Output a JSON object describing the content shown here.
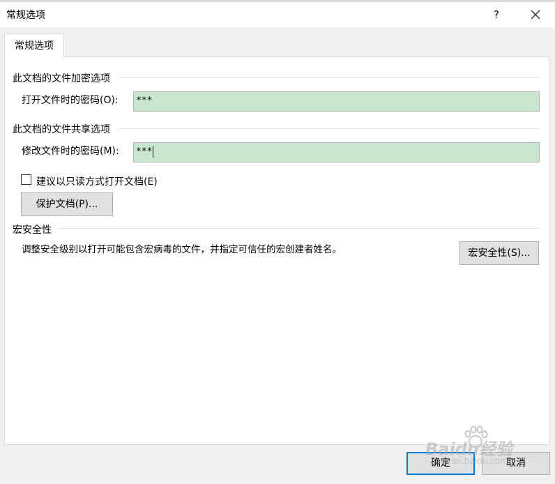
{
  "dialog": {
    "title": "常规选项",
    "help": "?"
  },
  "tab": {
    "label": "常规选项"
  },
  "encryption": {
    "heading": "此文档的文件加密选项",
    "open_label": "打开文件时的密码(O):",
    "open_value": "***"
  },
  "sharing": {
    "heading": "此文档的文件共享选项",
    "modify_label": "修改文件时的密码(M):",
    "modify_value": "***",
    "readonly_label": "建议以只读方式打开文档(E)",
    "readonly_checked": false,
    "protect_label": "保护文档(P)..."
  },
  "macro": {
    "heading": "宏安全性",
    "description": "调整安全级别以打开可能包含宏病毒的文件，并指定可信任的宏创建者姓名。",
    "button_label": "宏安全性(S)..."
  },
  "footer": {
    "ok_label": "确定",
    "cancel_label": "取消"
  },
  "watermark": {
    "brand": "Baidu经验",
    "url": "jingyan.baidu.com"
  },
  "colors": {
    "password_field": "#c9e7cf",
    "ok_border": "#0078d7"
  }
}
